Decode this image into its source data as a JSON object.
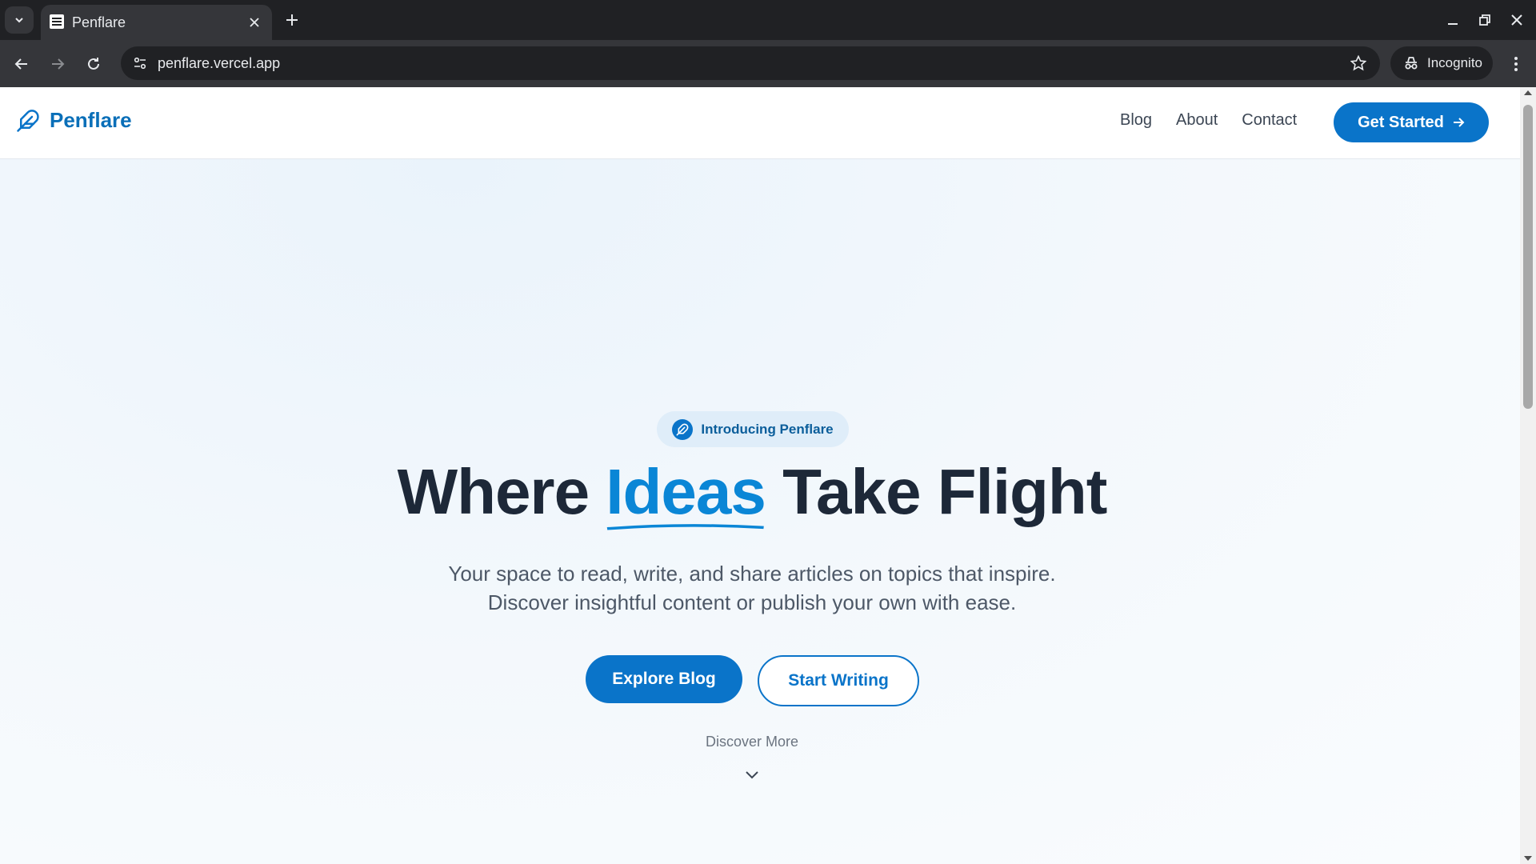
{
  "browser": {
    "tab_title": "Penflare",
    "url": "penflare.vercel.app",
    "incognito_label": "Incognito"
  },
  "site": {
    "brand": "Penflare",
    "nav": [
      {
        "label": "Blog"
      },
      {
        "label": "About"
      },
      {
        "label": "Contact"
      }
    ],
    "cta_label": "Get Started"
  },
  "hero": {
    "badge": "Introducing Penflare",
    "headline_before": "Where ",
    "headline_accent": "Ideas",
    "headline_after": " Take Flight",
    "subtitle": "Your space to read, write, and share articles on topics that inspire. Discover insightful content or publish your own with ease.",
    "primary_button": "Explore Blog",
    "secondary_button": "Start Writing",
    "discover_label": "Discover More"
  },
  "icons": {
    "brand": "feather-icon",
    "badge": "feather-icon",
    "cta": "arrow-right-icon",
    "discover": "chevron-down-icon"
  },
  "colors": {
    "brand_blue": "#0a74c9",
    "accent_text": "#0a86d6",
    "headline": "#1d2838",
    "chrome_dark": "#202124",
    "chrome_mid": "#35363a"
  }
}
